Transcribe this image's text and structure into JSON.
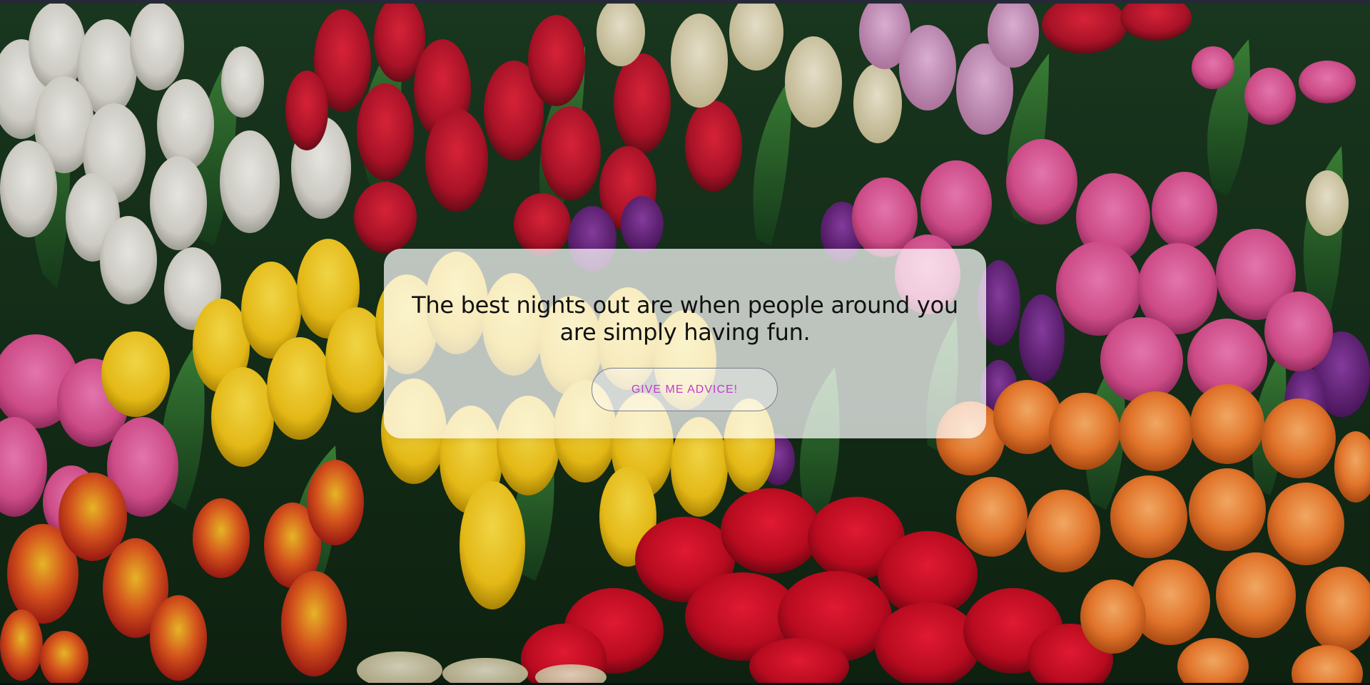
{
  "quote": {
    "text": "The best nights out are when people around you are simply having fun."
  },
  "advice_button": {
    "label": "GIVE ME ADVICE!"
  },
  "colors": {
    "button_text": "#c23bc8",
    "button_border": "#7a7f8c",
    "card_background": "rgba(255,255,255,0.72)",
    "quote_text": "#111111"
  }
}
